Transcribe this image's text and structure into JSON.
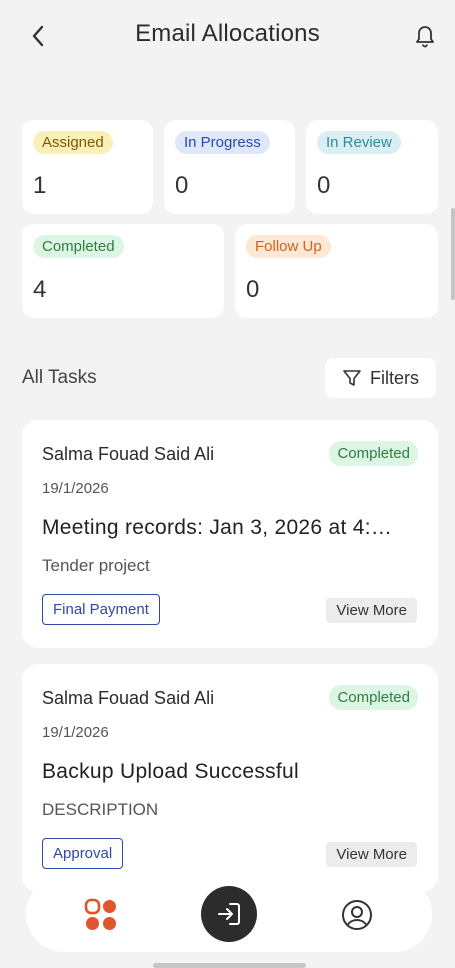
{
  "header": {
    "title": "Email Allocations",
    "back_icon": "chevron-left-icon",
    "bell_icon": "bell-icon"
  },
  "stats": {
    "assigned": {
      "label": "Assigned",
      "count": "1"
    },
    "in_progress": {
      "label": "In Progress",
      "count": "0"
    },
    "in_review": {
      "label": "In Review",
      "count": "0"
    },
    "completed": {
      "label": "Completed",
      "count": "4"
    },
    "follow_up": {
      "label": "Follow Up",
      "count": "0"
    }
  },
  "tasks_section": {
    "label": "All Tasks",
    "filters_label": "Filters",
    "filters_icon": "filter-icon"
  },
  "tasks": [
    {
      "assignee": "Salma Fouad Said Ali",
      "status": "Completed",
      "date": "19/1/2026",
      "title": "Meeting records: Jan 3, 2026 at 4:…",
      "description": "Tender project",
      "tag": "Final Payment",
      "view_more": "View More"
    },
    {
      "assignee": "Salma Fouad Said Ali",
      "status": "Completed",
      "date": "19/1/2026",
      "title": "Backup Upload Successful",
      "description": "DESCRIPTION",
      "tag": "Approval",
      "view_more": "View More"
    }
  ],
  "bottom_nav": {
    "items": [
      "grid-icon",
      "login-icon",
      "profile-icon"
    ],
    "accent_color": "#e0552d"
  }
}
